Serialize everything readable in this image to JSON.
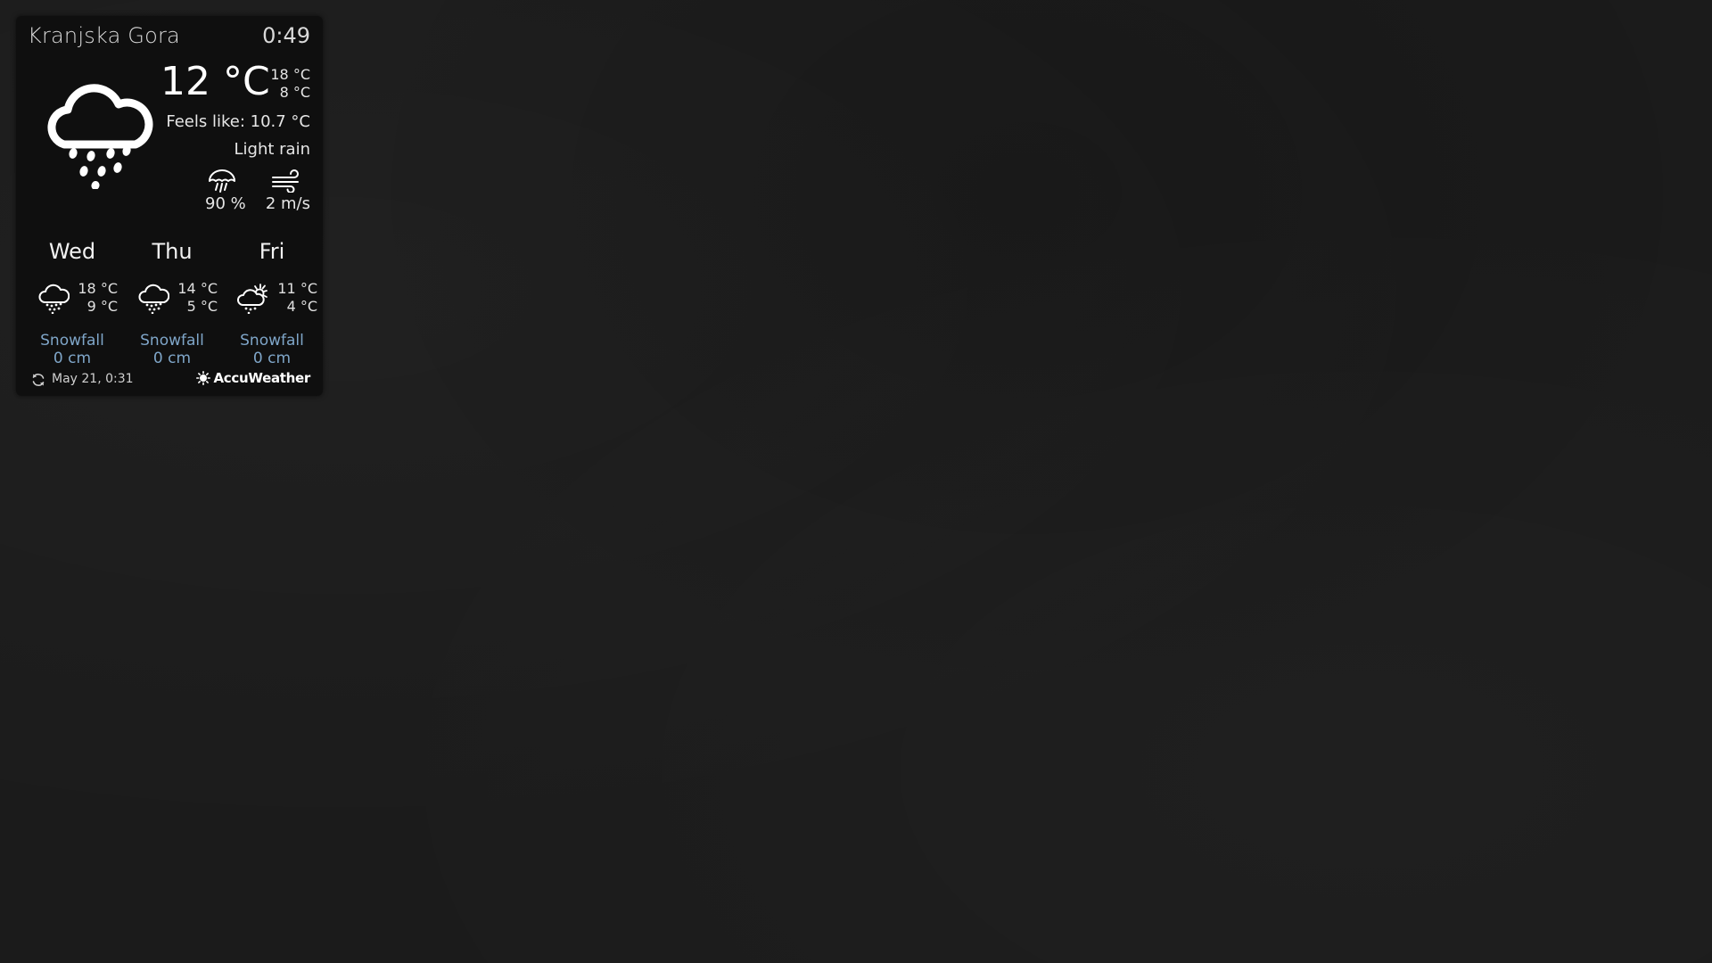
{
  "widget": {
    "location": "Kranjska Gora",
    "time": "0:49",
    "current": {
      "icon": "rain-cloud-icon",
      "temperature": "12 °C",
      "high": "18 °C",
      "low": "8 °C",
      "feels_like": "Feels like: 10.7 °C",
      "condition": "Light rain",
      "precipitation": "90 %",
      "wind": "2 m/s"
    },
    "forecast": [
      {
        "day": "Wed",
        "icon": "rain-cloud-icon",
        "high": "18 °C",
        "low": "9 °C",
        "snow_label": "Snowfall",
        "snow_value": "0 cm"
      },
      {
        "day": "Thu",
        "icon": "rain-cloud-icon",
        "high": "14 °C",
        "low": "5 °C",
        "snow_label": "Snowfall",
        "snow_value": "0 cm"
      },
      {
        "day": "Fri",
        "icon": "partly-sunny-cloud-icon",
        "high": "11 °C",
        "low": "4 °C",
        "snow_label": "Snowfall",
        "snow_value": "0 cm"
      }
    ],
    "footer": {
      "updated": "May 21, 0:31",
      "provider": "AccuWeather"
    },
    "colors": {
      "snowfall_text": "#7fa6c9",
      "panel_bg": "#0e0e0e",
      "page_bg": "#1b1b1b"
    }
  }
}
